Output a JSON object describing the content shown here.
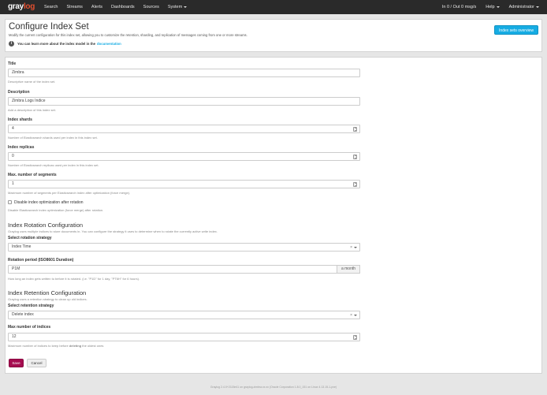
{
  "navbar": {
    "brand_main": "gray",
    "brand_accent": "log",
    "items": [
      "Search",
      "Streams",
      "Alerts",
      "Dashboards",
      "Sources",
      "System"
    ],
    "throughput": "In 0 / Out 0 msg/s",
    "help": "Help",
    "user": "Administrator"
  },
  "header": {
    "title": "Configure Index Set",
    "description": "Modify the current configuration for this index set, allowing you to customize the retention, sharding, and replication of messages coming from one or more streams.",
    "info_text": "You can learn more about the index model in the",
    "info_link": "documentation",
    "overview_button": "Index sets overview"
  },
  "form": {
    "title": {
      "label": "Title",
      "value": "Zimbra",
      "help": "Descriptive name of the index set."
    },
    "description": {
      "label": "Description",
      "value": "Zimbra Logs Indice",
      "help": "Add a description of this index set."
    },
    "shards": {
      "label": "Index shards",
      "value": "4",
      "help": "Number of Elasticsearch shards used per index in this index set."
    },
    "replicas": {
      "label": "Index replicas",
      "value": "0",
      "help": "Number of Elasticsearch replicas used per index in this index set."
    },
    "segments": {
      "label": "Max. number of segments",
      "value": "1",
      "help": "Maximum number of segments per Elasticsearch index after optimization (force merge)."
    },
    "disable_optimization": {
      "label": "Disable index optimization after rotation",
      "help": "Disable Elasticsearch index optimization (force merge) after rotation."
    },
    "rotation": {
      "title": "Index Rotation Configuration",
      "description": "Graylog uses multiple indices to store documents in. You can configure the strategy it uses to determine when to rotate the currently active write index.",
      "strategy_label": "Select rotation strategy",
      "strategy_value": "Index Time",
      "period_label": "Rotation period (ISO8601 Duration)",
      "period_value": "P1M",
      "period_addon": "a month",
      "period_help": "How long an index gets written to before it is rotated. (i.e. \"P1D\" for 1 day, \"PT6H\" for 6 hours)."
    },
    "retention": {
      "title": "Index Retention Configuration",
      "description": "Graylog uses a retention strategy to clean up old indices.",
      "strategy_label": "Select retention strategy",
      "strategy_value": "Delete index",
      "max_label": "Max number of indices",
      "max_value": "12",
      "max_help_prefix": "Maximum number of indices to keep before",
      "max_help_bold": "deleting",
      "max_help_suffix": "the oldest ones"
    },
    "save_button": "Save",
    "cancel_button": "Cancel"
  },
  "footer": "Graylog 2.4.0+2115e41 on graylog.zimbra.xx.xx (Oracle Corporation 1.8.0_151 on Linux 4.13.15-1-pve)"
}
